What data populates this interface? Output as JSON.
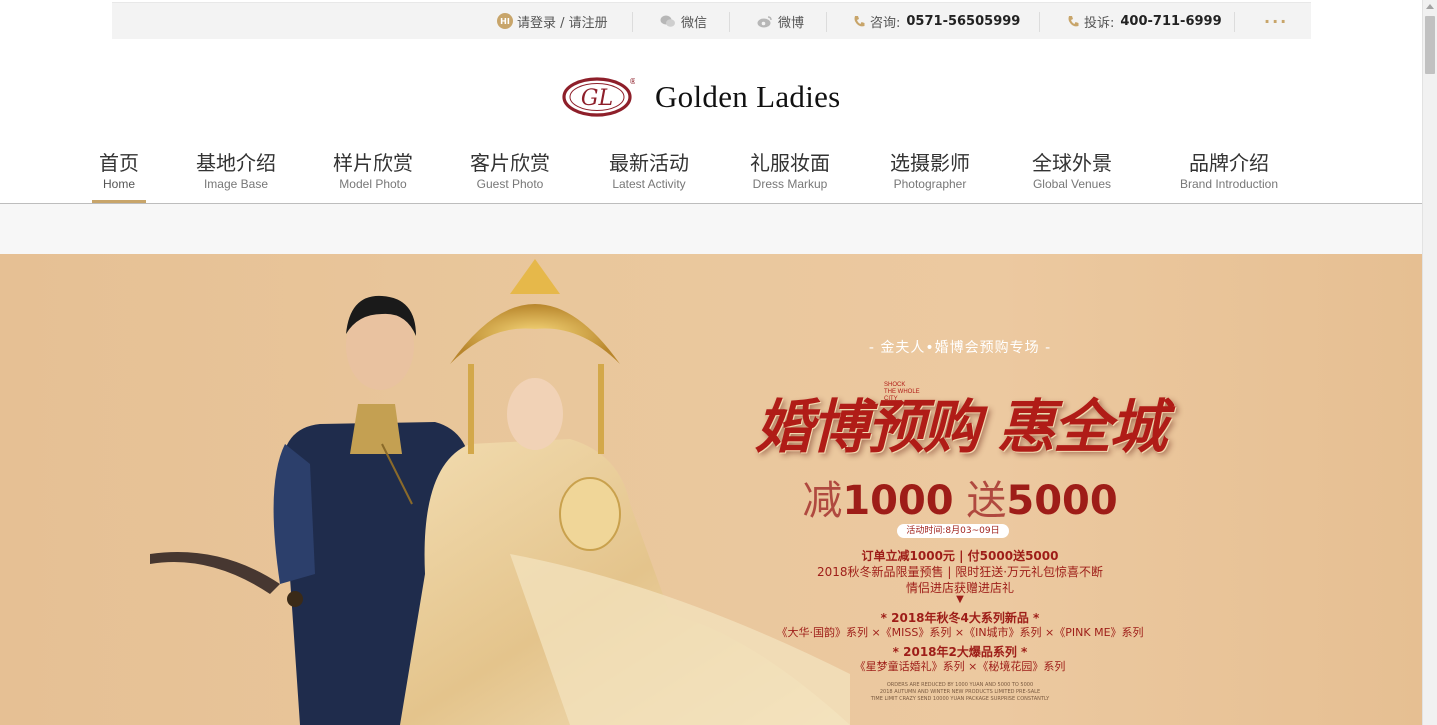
{
  "topbar": {
    "login": {
      "badge": "HI",
      "label": "请登录 / 请注册"
    },
    "wechat": "微信",
    "weibo": "微博",
    "consult_label": "咨询:",
    "consult_phone": "0571-56505999",
    "complaint_label": "投诉:",
    "complaint_phone": "400-711-6999",
    "more": "···"
  },
  "logo": {
    "monogram": "GL",
    "text": "Golden Ladies",
    "mark": "®"
  },
  "nav": {
    "items": [
      {
        "cn": "首页",
        "en": "Home"
      },
      {
        "cn": "基地介绍",
        "en": "Image Base"
      },
      {
        "cn": "样片欣赏",
        "en": "Model Photo"
      },
      {
        "cn": "客片欣赏",
        "en": "Guest Photo"
      },
      {
        "cn": "最新活动",
        "en": "Latest Activity"
      },
      {
        "cn": "礼服妆面",
        "en": "Dress Markup"
      },
      {
        "cn": "选摄影师",
        "en": "Photographer"
      },
      {
        "cn": "全球外景",
        "en": "Global Venues"
      },
      {
        "cn": "品牌介绍",
        "en": "Brand Introduction"
      }
    ],
    "active_index": 0
  },
  "banner": {
    "pre_title": "- 金夫人•婚博会预购专场 -",
    "title": "婚博预购 惠全城",
    "shock": [
      "SHOCK",
      "THE WHOLE",
      "CITY"
    ],
    "promo_reduce": "减",
    "promo_reduce_amount": "1000",
    "promo_gift": "送",
    "promo_gift_amount": "5000",
    "date": "活动时间:8月03~09日",
    "line1": "订单立减1000元 | 付5000送5000",
    "line2": "2018秋冬新品限量预售 | 限时狂送·万元礼包惊喜不断",
    "line3": "情侣进店获赠进店礼",
    "arrow": "▼",
    "line4": "* 2018年秋冬4大系列新品 *",
    "line5": "《大华·国韵》系列 ×《MISS》系列 ×《IN城市》系列 ×《PINK ME》系列",
    "line6": "* 2018年2大爆品系列 *",
    "line7": "《星梦童话婚礼》系列 ×《秘境花园》系列",
    "fine_print": [
      "ORDERS ARE REDUCED BY 1000 YUAN AND 5000 TO 5000",
      "2018 AUTUMN AND WINTER NEW PRODUCTS LIMITED PRE-SALE",
      "TIME LIMIT CRAZY SEND 10000 YUAN PACKAGE SURPRISE CONSTANTLY"
    ]
  },
  "colors": {
    "gold": "#c8a56a",
    "banner_red": "#b01c17",
    "banner_bg": "#e9c79c"
  }
}
